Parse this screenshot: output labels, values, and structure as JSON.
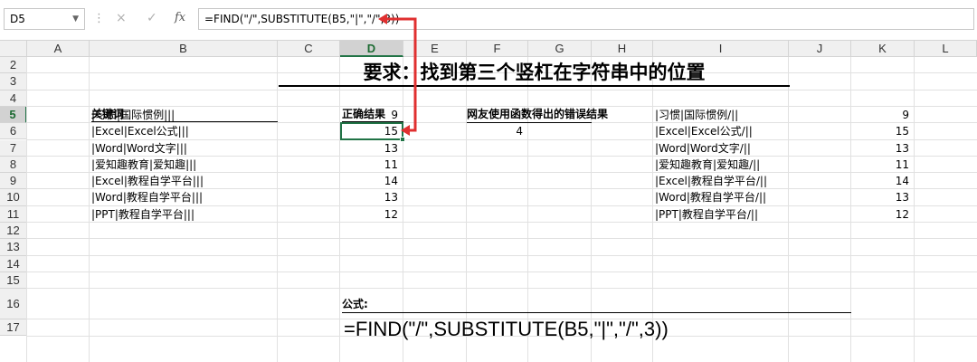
{
  "formula_bar": {
    "name_box": "D5",
    "cancel_icon": "×",
    "enter_icon": "✓",
    "fx_label": "fx",
    "formula": "=FIND(\"/\",SUBSTITUTE(B5,\"|\",\"/\",3))"
  },
  "columns": [
    "A",
    "B",
    "C",
    "D",
    "E",
    "F",
    "G",
    "H",
    "I",
    "J",
    "K",
    "L"
  ],
  "rows": [
    "2",
    "3",
    "4",
    "5",
    "6",
    "7",
    "8",
    "9",
    "10",
    "11",
    "12",
    "13",
    "14",
    "15",
    "16",
    "17"
  ],
  "selected": {
    "column": "D",
    "row": "5"
  },
  "sheet": {
    "title": "要求：找到第三个竖杠在字符串中的位置",
    "keyword_header": "关键词",
    "correct_header": "正确结果",
    "wrong_header": "网友使用函数得出的错误结果",
    "keywords": [
      "|习惯|国际惯例|||",
      "|Excel|Excel公式|||",
      "|Word|Word文字|||",
      "|爱知趣教育|爱知趣|||",
      "|Excel|教程自学平台|||",
      "|Word|教程自学平台|||",
      "|PPT|教程自学平台|||"
    ],
    "correct_results": [
      "9",
      "15",
      "13",
      "11",
      "14",
      "13",
      "12"
    ],
    "wrong_result": "4",
    "substituted": [
      "|习惯|国际惯例/||",
      "|Excel|Excel公式/||",
      "|Word|Word文字/||",
      "|爱知趣教育|爱知趣/||",
      "|Excel|教程自学平台/||",
      "|Word|教程自学平台/||",
      "|PPT|教程自学平台/||"
    ],
    "substituted_results": [
      "9",
      "15",
      "13",
      "11",
      "14",
      "13",
      "12"
    ],
    "formula_label": "公式:",
    "formula_display": "=FIND(\"/\",SUBSTITUTE(B5,\"|\",\"/\",3))"
  },
  "colors": {
    "selection": "#217346",
    "arrow": "#e03030"
  }
}
